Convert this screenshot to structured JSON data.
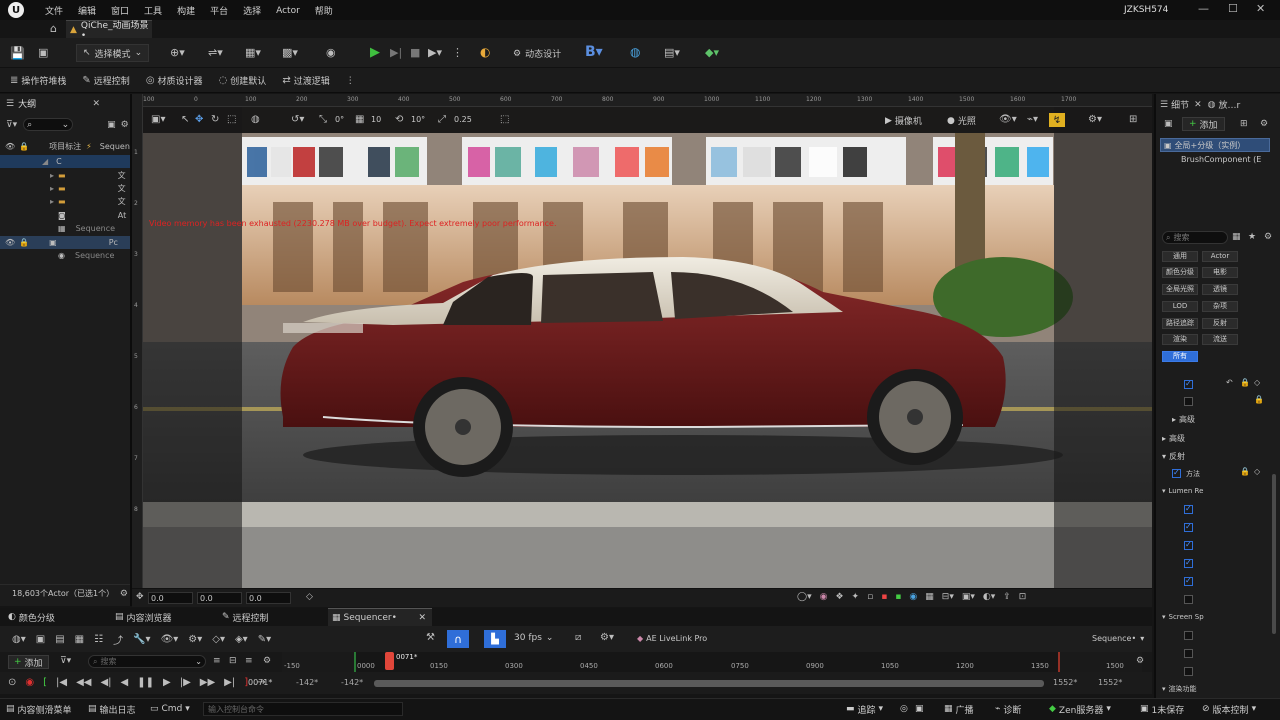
{
  "window": {
    "menu": [
      "文件",
      "编辑",
      "窗口",
      "工具",
      "构建",
      "平台",
      "选择",
      "Actor",
      "帮助"
    ],
    "user": "JZKSH574",
    "doc_tab": "QiChe_动画场景•"
  },
  "toolbar1": {
    "mode_label": "选择模式",
    "dynamic_design": "动态设计"
  },
  "toolbar2": {
    "items": [
      "操作符堆栈",
      "远程控制",
      "材质设计器",
      "创建默认",
      "过渡逻辑"
    ]
  },
  "outliner": {
    "title": "大纲",
    "rows": [
      {
        "label": "项目标注",
        "extra": "Sequen"
      },
      {
        "label": "",
        "extra": "C"
      },
      {
        "label": "文"
      },
      {
        "label": "文"
      },
      {
        "label": "文"
      },
      {
        "label": "At"
      },
      {
        "label": "Sequence"
      },
      {
        "label": "Pc"
      },
      {
        "label": "Sequence"
      }
    ],
    "actor_count": "18,603个Actor（已选1个）"
  },
  "ruler": {
    "top": [
      "100",
      "0",
      "100",
      "200",
      "300",
      "400",
      "500",
      "600",
      "700",
      "800",
      "900",
      "1000",
      "1100",
      "1200",
      "1300",
      "1400",
      "1500",
      "1600",
      "1700"
    ],
    "left": [
      "1",
      "2",
      "3",
      "4",
      "5",
      "6",
      "7",
      "8"
    ]
  },
  "viewport": {
    "camera_label": "摄像机",
    "lighting_label": "光照",
    "grid_values": [
      "0°",
      "10",
      "10°",
      "0.25"
    ],
    "warning": "Video memory has been exhausted (2230.278 MB over budget). Expect extremely poor performance.",
    "bottom_fields": [
      "0.0",
      "0.0",
      "0.0"
    ]
  },
  "details": {
    "tab_details": "细节",
    "tab_other": "放…r",
    "add_label": "添加",
    "selected": "全局+分级（实例）",
    "component": "BrushComponent (E",
    "search_placeholder": "搜索",
    "filters": [
      "通用",
      "Actor",
      "颜色分级",
      "电影",
      "全局光照",
      "透镜",
      "LOD",
      "杂项",
      "路径追踪",
      "反射",
      "渲染",
      "流送",
      "所有"
    ],
    "sections": [
      "高级",
      "高级",
      "反射",
      "方法",
      "Lumen Re",
      "Screen Sp",
      "渲染功能"
    ]
  },
  "sequencer": {
    "tabs": [
      "颜色分级",
      "内容浏览器",
      "远程控制",
      "Sequencer•"
    ],
    "fps": "30 fps",
    "livelink": "AE LiveLink Pro",
    "seq_name": "Sequence•",
    "add_label": "添加",
    "search_placeholder": "搜索",
    "timeline_labels": [
      "-150",
      "0000",
      "0150",
      "0300",
      "0450",
      "0600",
      "0750",
      "0900",
      "1050",
      "1200",
      "1350",
      "1500"
    ],
    "current_frame": "0071*",
    "frame_field": "0071*",
    "range_start": "-142*",
    "range_start2": "-142*",
    "range_end": "1552*",
    "range_end2": "1552*",
    "progress": 0.0
  },
  "statusbar": {
    "content_drawer": "内容侧滑菜单",
    "output_log": "输出日志",
    "cmd": "Cmd",
    "console_placeholder": "输入控制台命令",
    "trace": "追踪",
    "broadcast": "广播",
    "diagnostics": "诊断",
    "zen": "Zen服务器",
    "unsaved": "1未保存",
    "version_control": "版本控制"
  },
  "colors": {
    "accent": "#2f6ed8",
    "play_green": "#3fbf3f",
    "playhead_red": "#e0463a"
  }
}
